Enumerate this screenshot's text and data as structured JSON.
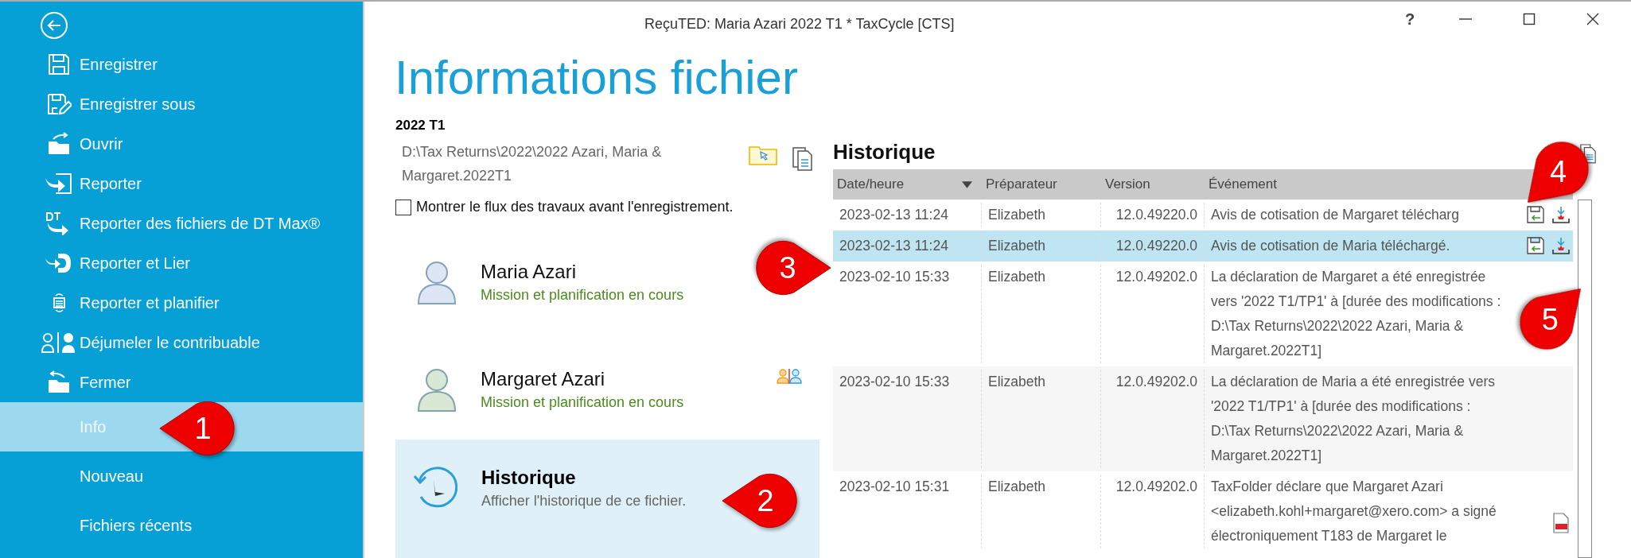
{
  "window": {
    "title": "ReçuTED: Maria Azari 2022 T1 * TaxCycle [CTS]",
    "controls": [
      "?"
    ]
  },
  "sidebar": {
    "items": [
      {
        "label": "Enregistrer",
        "selected": false
      },
      {
        "label": "Enregistrer sous",
        "selected": false
      },
      {
        "label": "Ouvrir",
        "selected": false
      },
      {
        "label": "Reporter",
        "selected": false
      },
      {
        "label": "Reporter des fichiers de DT Max®",
        "selected": false
      },
      {
        "label": "Reporter et Lier",
        "selected": false
      },
      {
        "label": "Reporter et planifier",
        "selected": false
      },
      {
        "label": "Déjumeler le contribuable",
        "selected": false
      },
      {
        "label": "Fermer",
        "selected": false
      },
      {
        "label": "Info",
        "selected": true
      },
      {
        "label": "Nouveau",
        "selected": false
      },
      {
        "label": "Fichiers récents",
        "selected": false
      }
    ]
  },
  "page_title": "Informations fichier",
  "file": {
    "name": "2022 T1",
    "path": "D:\\Tax Returns\\2022\\2022 Azari, Maria & Margaret.2022T1"
  },
  "workflow_checkbox": {
    "label": "Montrer le flux des travaux avant l'enregistrement.",
    "checked": false
  },
  "taxpayers": [
    {
      "name": "Maria Azari",
      "status": "Mission et planification en cours",
      "color": "#dde6f5"
    },
    {
      "name": "Margaret Azari",
      "status": "Mission et planification en cours",
      "color": "#d9e8d4"
    }
  ],
  "history_card": {
    "title": "Historique",
    "description": "Afficher l'historique de ce fichier.",
    "selected": true
  },
  "history": {
    "title": "Historique",
    "columns": [
      "Date/heure",
      "Préparateur",
      "Version",
      "Événement"
    ],
    "rows": [
      {
        "date": "2023-02-13 11:24",
        "preparer": "Elizabeth",
        "version": "12.0.49220.0",
        "event": "Avis de cotisation de Margaret télécharg",
        "kind": "assessment",
        "selected": false
      },
      {
        "date": "2023-02-13 11:24",
        "preparer": "Elizabeth",
        "version": "12.0.49220.0",
        "event": "Avis de cotisation de Maria téléchargé.",
        "kind": "assessment",
        "selected": true
      },
      {
        "date": "2023-02-10 15:33",
        "preparer": "Elizabeth",
        "version": "12.0.49202.0",
        "event": "La déclaration de Margaret a été enregistrée vers '2022 T1/TP1' à [durée des modifications : D:\\Tax Returns\\2022\\2022 Azari, Maria & Margaret.2022T1]",
        "kind": "saved",
        "selected": false
      },
      {
        "date": "2023-02-10 15:33",
        "preparer": "Elizabeth",
        "version": "12.0.49202.0",
        "event": "La déclaration de Maria a été enregistrée vers '2022 T1/TP1' à [durée des modifications : D:\\Tax Returns\\2022\\2022 Azari, Maria & Margaret.2022T1]",
        "kind": "saved",
        "selected": false
      },
      {
        "date": "2023-02-10 15:31",
        "preparer": "Elizabeth",
        "version": "12.0.49202.0",
        "event": "TaxFolder déclare que Margaret Azari <elizabeth.kohl+margaret@xero.com> a signé électroniquement T183 de Margaret le",
        "kind": "signed",
        "selected": false
      }
    ]
  },
  "callouts": [
    {
      "label": "1"
    },
    {
      "label": "2"
    },
    {
      "label": "3"
    },
    {
      "label": "4"
    },
    {
      "label": "5"
    }
  ]
}
